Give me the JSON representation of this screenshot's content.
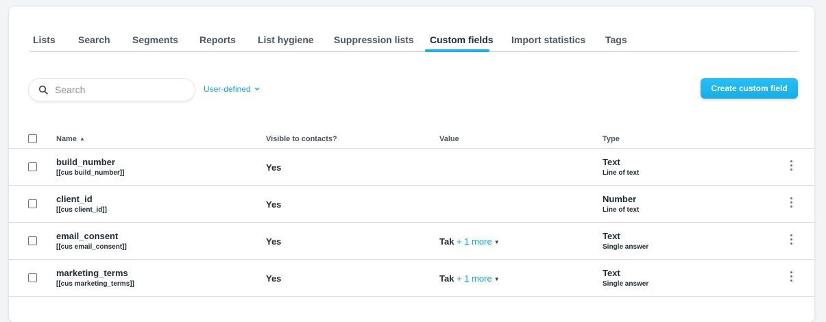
{
  "tabs": [
    {
      "label": "Lists",
      "active": false
    },
    {
      "label": "Search",
      "active": false
    },
    {
      "label": "Segments",
      "active": false
    },
    {
      "label": "Reports",
      "active": false
    },
    {
      "label": "List hygiene",
      "active": false
    },
    {
      "label": "Suppression lists",
      "active": false
    },
    {
      "label": "Custom fields",
      "active": true
    },
    {
      "label": "Import statistics",
      "active": false
    },
    {
      "label": "Tags",
      "active": false
    }
  ],
  "toolbar": {
    "search_placeholder": "Search",
    "search_value": "",
    "filter_label": "User-defined",
    "create_label": "Create custom field"
  },
  "table": {
    "columns": {
      "name": "Name",
      "visible": "Visible to contacts?",
      "value": "Value",
      "type": "Type"
    },
    "sort": "ascending",
    "rows": [
      {
        "name": "build_number",
        "tag": "[[cus build_number]]",
        "visible": "Yes",
        "value": "",
        "more": "",
        "type": "Text",
        "subtype": "Line of text"
      },
      {
        "name": "client_id",
        "tag": "[[cus client_id]]",
        "visible": "Yes",
        "value": "",
        "more": "",
        "type": "Number",
        "subtype": "Line of text"
      },
      {
        "name": "email_consent",
        "tag": "[[cus email_consent]]",
        "visible": "Yes",
        "value": "Tak",
        "more": "+ 1 more",
        "type": "Text",
        "subtype": "Single answer"
      },
      {
        "name": "marketing_terms",
        "tag": "[[cus marketing_terms]]",
        "visible": "Yes",
        "value": "Tak",
        "more": "+ 1 more",
        "type": "Text",
        "subtype": "Single answer"
      }
    ]
  },
  "colors": {
    "accent": "#1ab1ef",
    "link": "#1aa2dd",
    "text": "#1f2a37"
  },
  "icons": {
    "search": "search-icon",
    "filter": "chevron-down-icon",
    "row_menu": "kebab-menu-icon",
    "sort": "sort-ascending-icon"
  }
}
